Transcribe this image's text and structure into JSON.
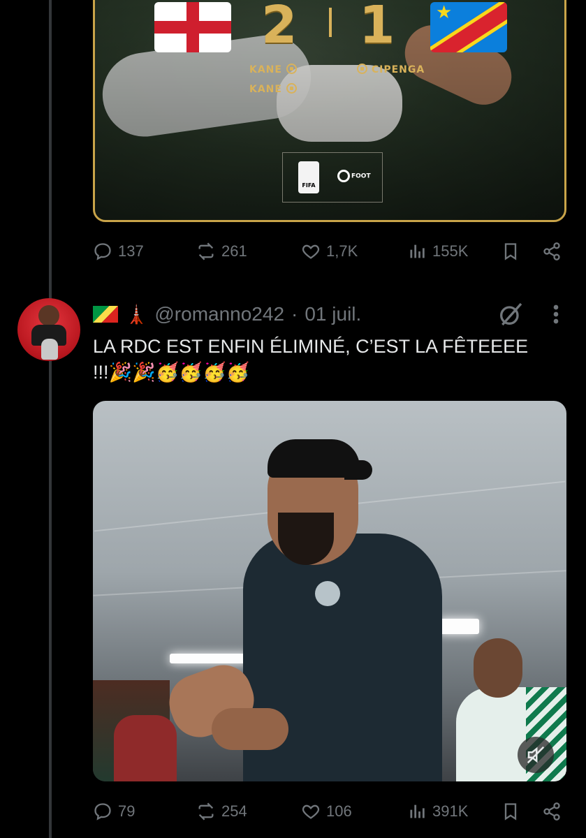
{
  "match_card": {
    "home_score": "2",
    "away_score": "1",
    "home_scorers": [
      "KANE",
      "KANE"
    ],
    "away_scorers": [
      "CIPENGA"
    ],
    "logo_fifa_text": "FIFA",
    "logo_foot_text": "FOOT"
  },
  "tweet1": {
    "replies": "137",
    "retweets": "261",
    "likes": "1,7K",
    "views": "155K"
  },
  "tweet2": {
    "handle": "@romanno242",
    "separator": "·",
    "date": "01 juil.",
    "text": "LA RDC EST ENFIN ÉLIMINÉ, C’EST LA FÊTEEEE !!!🎉🎉🥳🥳🥳🥳",
    "replies": "79",
    "retweets": "254",
    "likes": "106",
    "views": "391K"
  },
  "colors": {
    "background": "#000000",
    "muted": "#71767b",
    "text": "#e7e9ea",
    "gold": "#c9a449"
  },
  "icons": [
    "reply-icon",
    "retweet-icon",
    "like-icon",
    "views-icon",
    "bookmark-icon",
    "share-icon",
    "grok-icon",
    "more-icon",
    "mute-icon",
    "soccer-ball-icon"
  ]
}
